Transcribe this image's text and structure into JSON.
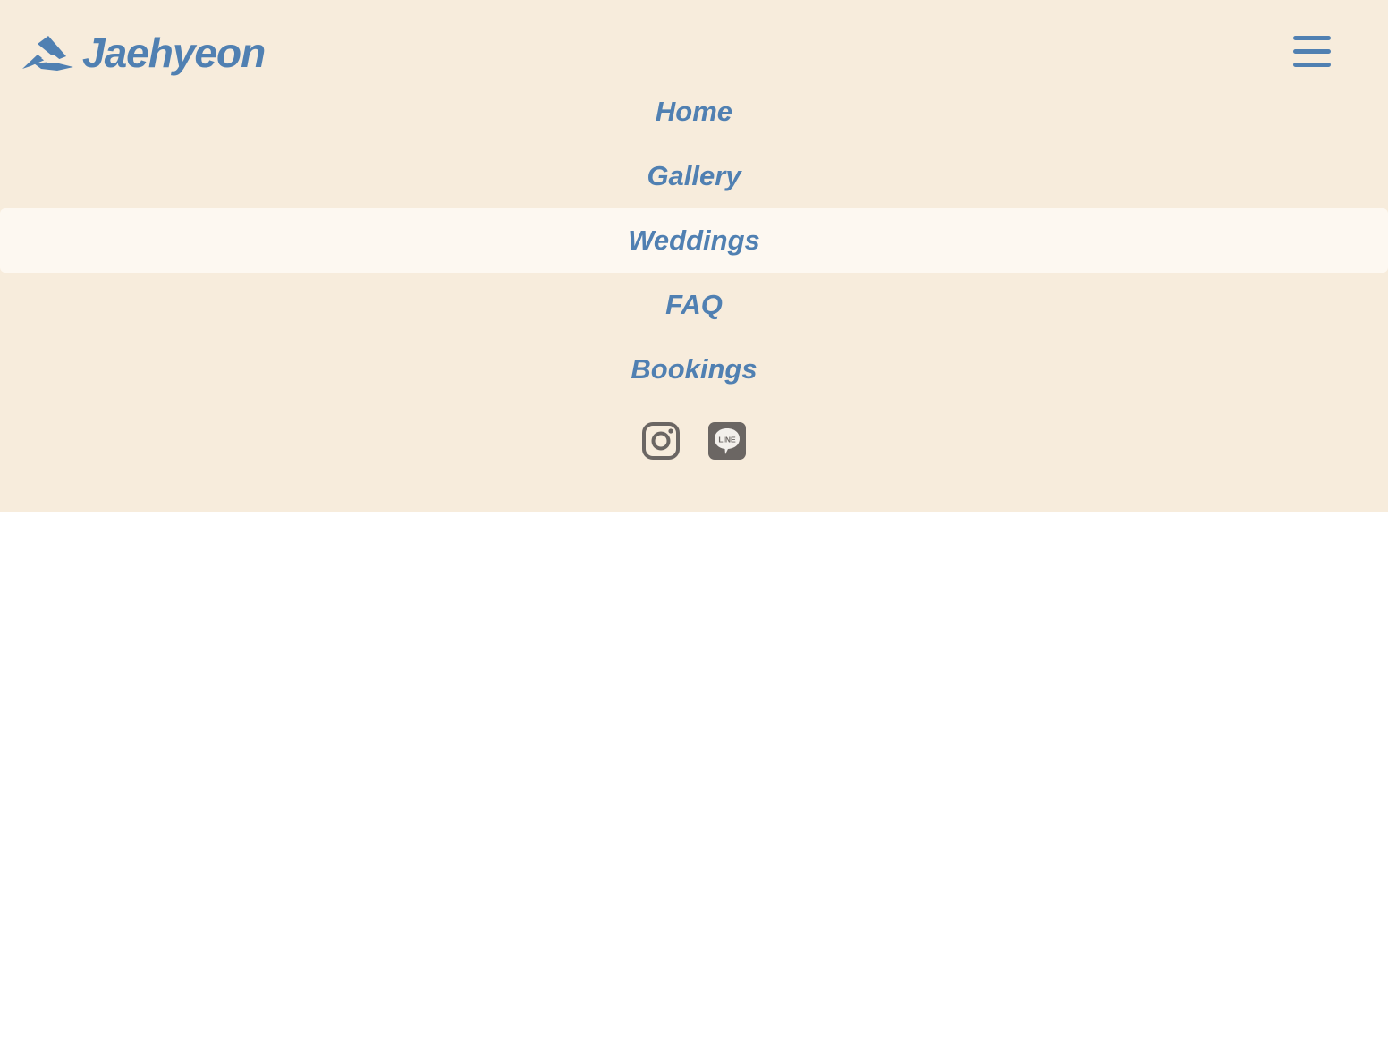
{
  "brand": {
    "name": "Jaehyeon",
    "logo_icon": "mountain-logo-icon"
  },
  "menu_toggle": {
    "icon": "hamburger-menu-icon"
  },
  "nav": {
    "items": [
      {
        "label": "Home",
        "active": false
      },
      {
        "label": "Gallery",
        "active": false
      },
      {
        "label": "Weddings",
        "active": true
      },
      {
        "label": "FAQ",
        "active": false
      },
      {
        "label": "Bookings",
        "active": false
      }
    ]
  },
  "social": {
    "instagram_icon": "instagram-icon",
    "line_icon": "line-icon",
    "line_text": "LINE"
  },
  "colors": {
    "accent": "#5080b2",
    "panel_bg": "#f7ecdc",
    "active_item_bg": "#fdf8f1",
    "icon_gray": "#6b6663",
    "page_bg": "#ffffff"
  }
}
